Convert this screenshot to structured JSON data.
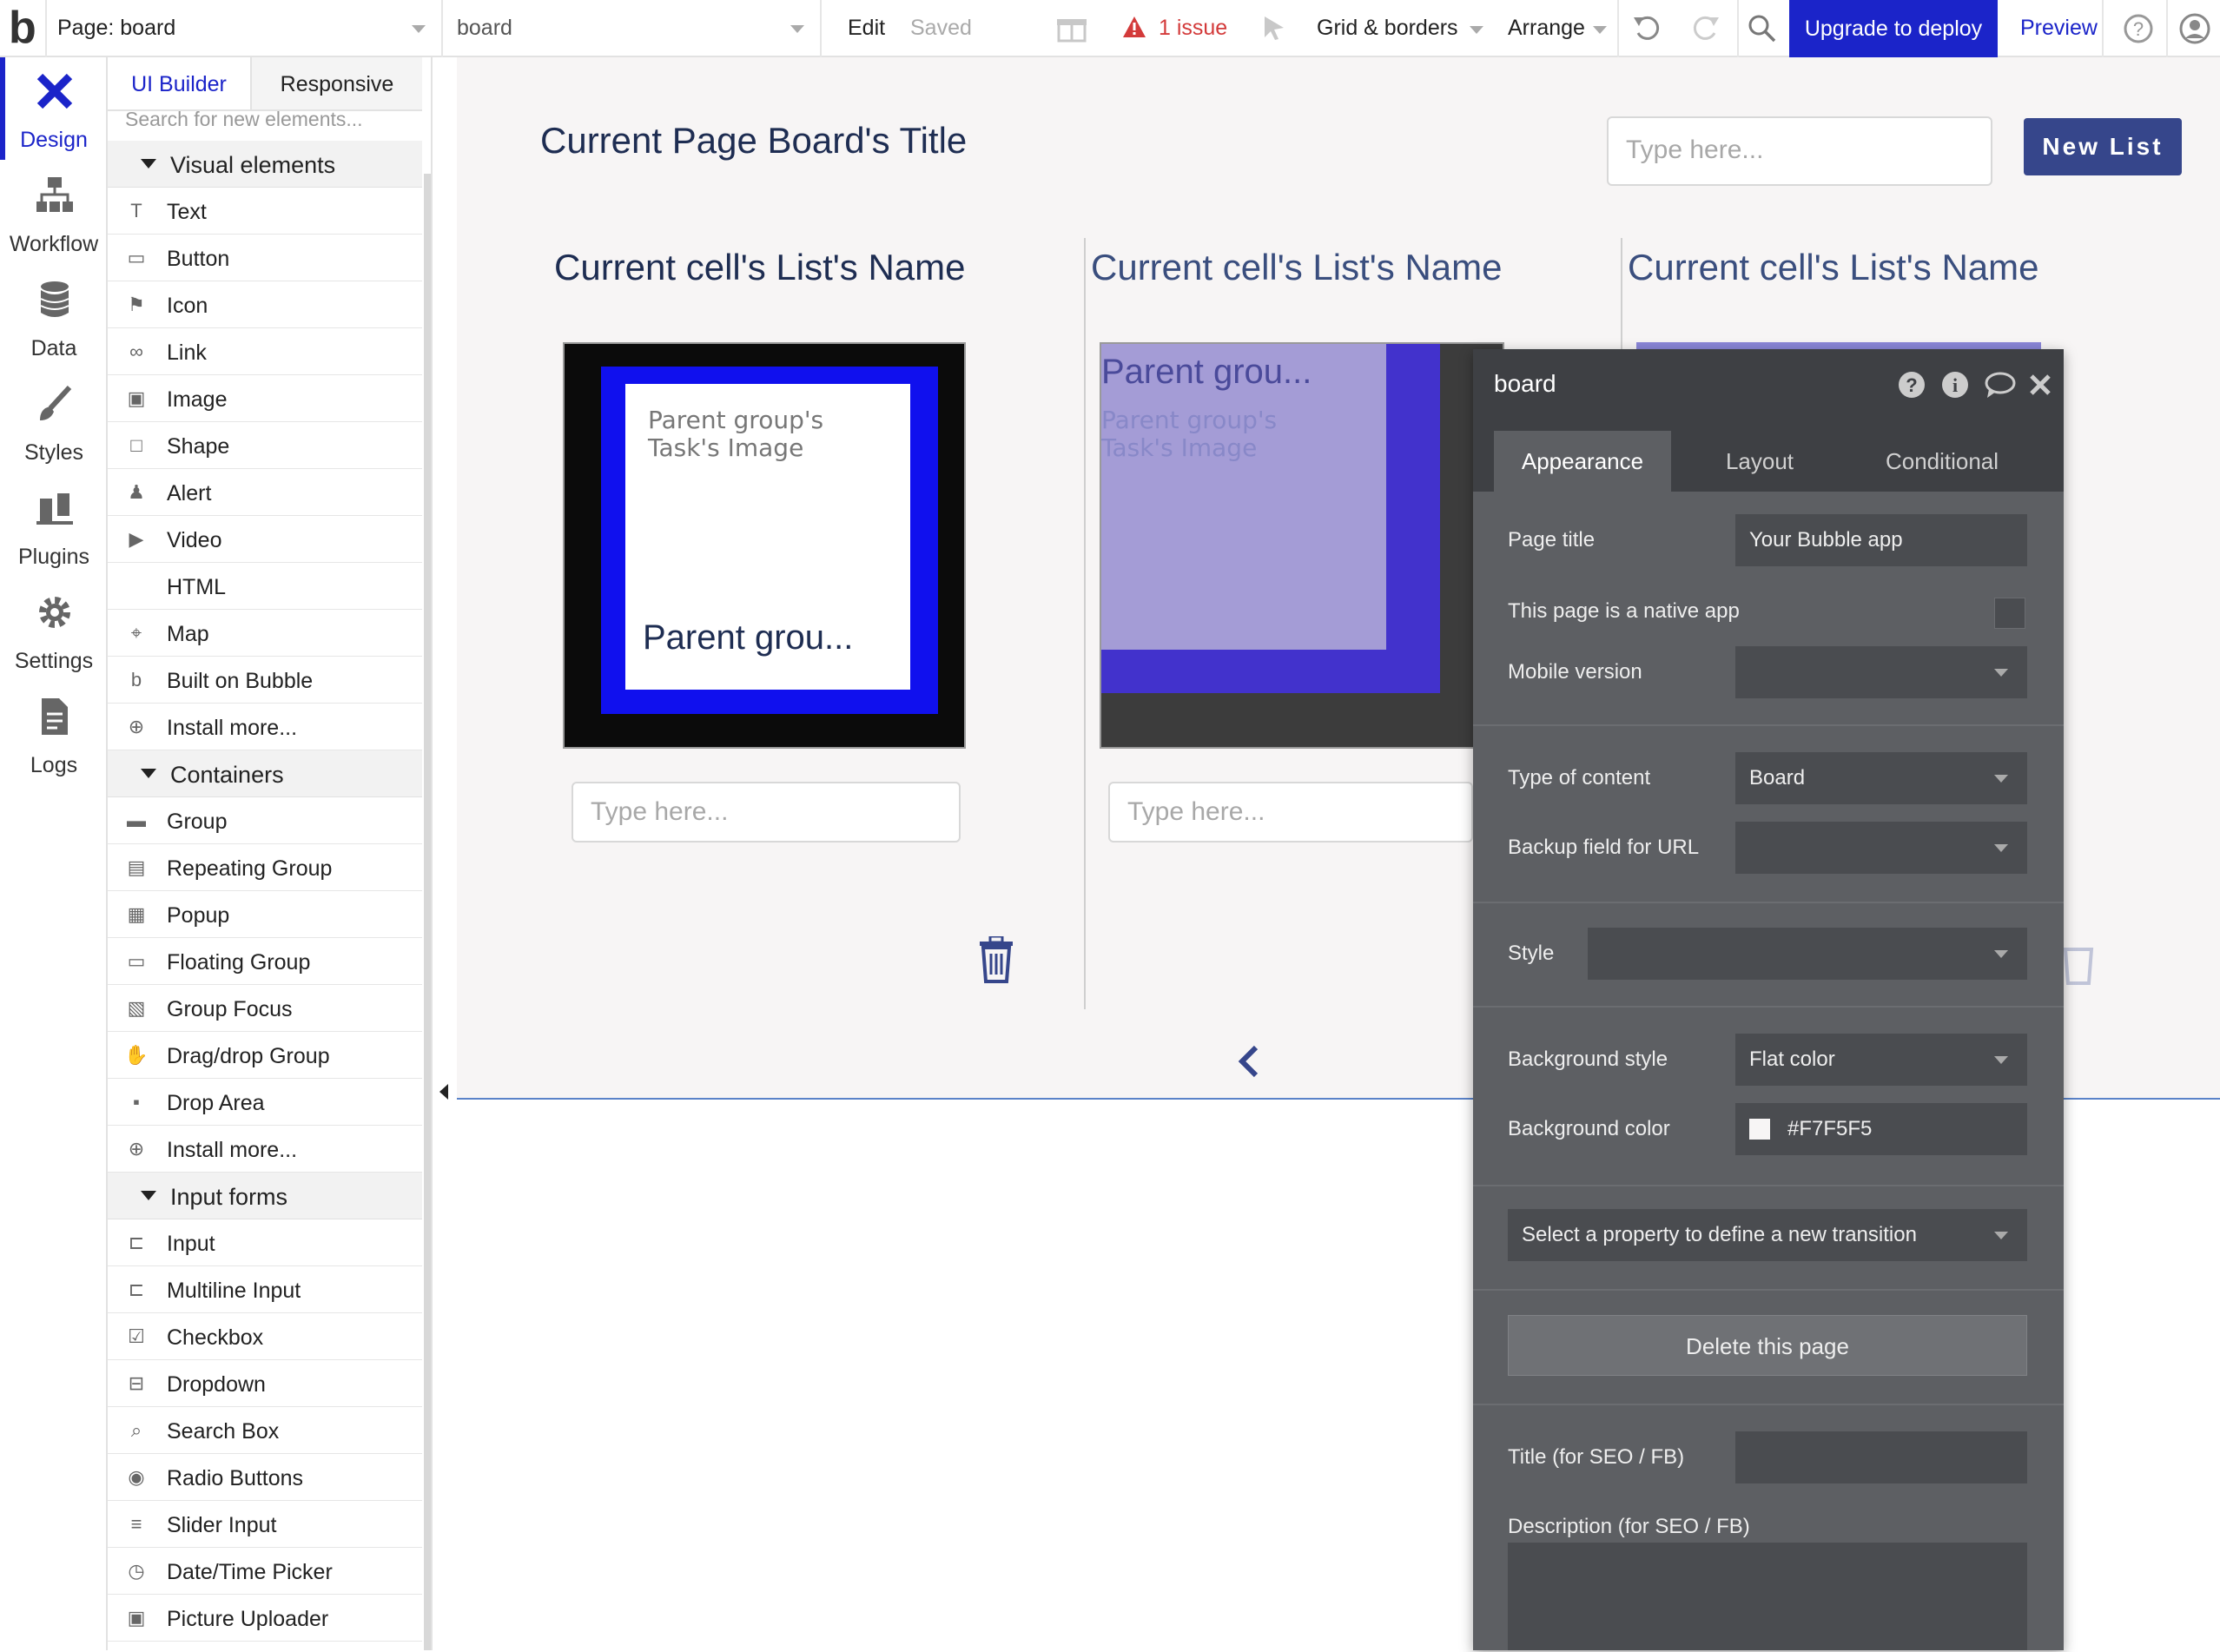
{
  "topbar": {
    "logo": "b",
    "page_select": "Page: board",
    "page_name": "board",
    "edit": "Edit",
    "saved": "Saved",
    "issue": "1 issue",
    "grid": "Grid & borders",
    "arrange": "Arrange",
    "upgrade": "Upgrade to deploy",
    "preview": "Preview",
    "accent": "#1b24c9",
    "issue_color": "#d33a3a"
  },
  "rail": {
    "items": [
      {
        "label": "Design",
        "icon": "design-icon"
      },
      {
        "label": "Workflow",
        "icon": "workflow-icon"
      },
      {
        "label": "Data",
        "icon": "database-icon"
      },
      {
        "label": "Styles",
        "icon": "brush-icon"
      },
      {
        "label": "Plugins",
        "icon": "plug-icon"
      },
      {
        "label": "Settings",
        "icon": "gear-icon"
      },
      {
        "label": "Logs",
        "icon": "document-icon"
      }
    ]
  },
  "panel": {
    "tabs": [
      "UI Builder",
      "Responsive"
    ],
    "search_placeholder": "Search for new elements...",
    "visual_header": "Visual elements",
    "visual": [
      "Text",
      "Button",
      "Icon",
      "Link",
      "Image",
      "Shape",
      "Alert",
      "Video",
      "HTML",
      "Map",
      "Built on Bubble",
      "Install more..."
    ],
    "containers_header": "Containers",
    "containers": [
      "Group",
      "Repeating Group",
      "Popup",
      "Floating Group",
      "Group Focus",
      "Drag/drop Group",
      "Drop Area",
      "Install more..."
    ],
    "inputs_header": "Input forms",
    "inputs": [
      "Input",
      "Multiline Input",
      "Checkbox",
      "Dropdown",
      "Search Box",
      "Radio Buttons",
      "Slider Input",
      "Date/Time Picker",
      "Picture Uploader"
    ]
  },
  "canvas": {
    "board_title": "Current Page Board's Title",
    "type_here": "Type here...",
    "new_list": "New List",
    "list_name": "Current cell's List's Name",
    "task_image": "Parent group's Task's Image",
    "parent_group": "Parent grou..."
  },
  "editor": {
    "title": "board",
    "tabs": [
      "Appearance",
      "Layout",
      "Conditional"
    ],
    "page_title_label": "Page title",
    "page_title_value": "Your Bubble app",
    "native_label": "This page is a native app",
    "mobile_label": "Mobile version",
    "content_label": "Type of content",
    "content_value": "Board",
    "backup_label": "Backup field for URL",
    "style_label": "Style",
    "bg_style_label": "Background style",
    "bg_style_value": "Flat color",
    "bg_color_label": "Background color",
    "bg_color_value": "#F7F5F5",
    "transition": "Select a property to define a new transition",
    "delete": "Delete this page",
    "seo_title_label": "Title (for SEO / FB)",
    "seo_desc_label": "Description (for SEO / FB)"
  }
}
